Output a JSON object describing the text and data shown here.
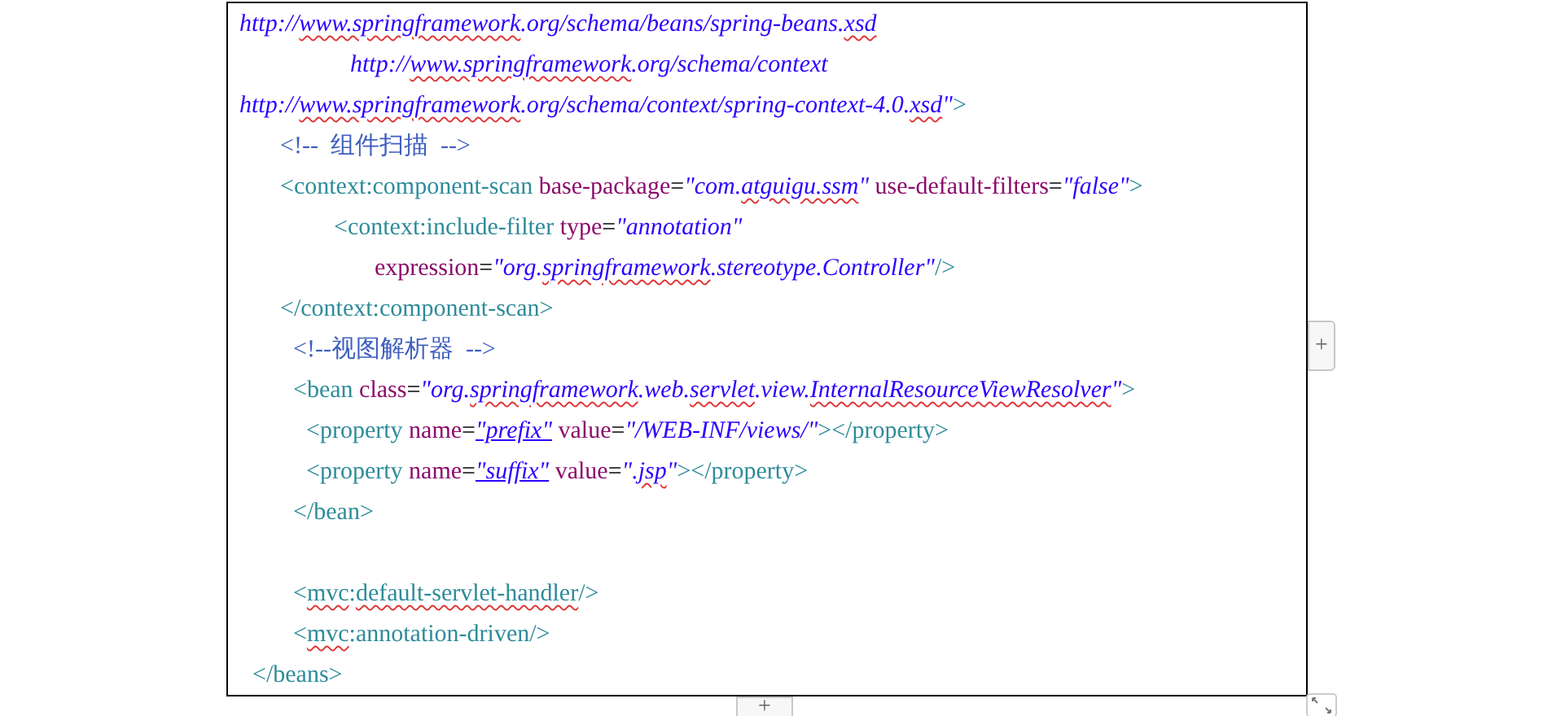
{
  "code_lines": [
    {
      "segments": [
        {
          "kind": "value",
          "text": "http://",
          "flag": false
        },
        {
          "kind": "value",
          "text": "www.springframework",
          "flag": true
        },
        {
          "kind": "value",
          "text": ".org/schema/beans/spring-beans.",
          "flag": false
        },
        {
          "kind": "value",
          "text": "xsd",
          "flag": true
        }
      ]
    },
    {
      "segments": [
        {
          "kind": "value",
          "text": "http://",
          "flag": false
        },
        {
          "kind": "value",
          "text": "www.springframework",
          "flag": true
        },
        {
          "kind": "value",
          "text": ".org/schema/context",
          "flag": false
        }
      ]
    },
    {
      "segments": [
        {
          "kind": "value",
          "text": "http://",
          "flag": false
        },
        {
          "kind": "value",
          "text": "www.springframework",
          "flag": true
        },
        {
          "kind": "value",
          "text": ".org/schema/context/spring-context-4.0.",
          "flag": false
        },
        {
          "kind": "value",
          "text": "xsd",
          "flag": true
        },
        {
          "kind": "value",
          "text": "\"",
          "flag": false
        },
        {
          "kind": "tag",
          "text": ">",
          "flag": false
        }
      ]
    },
    {
      "segments": [
        {
          "kind": "comment",
          "text": "<!--  组件扫描  -->",
          "flag": false
        }
      ]
    },
    {
      "segments": [
        {
          "kind": "tag",
          "text": "<context:component-scan ",
          "flag": false
        },
        {
          "kind": "attr",
          "text": "base-package",
          "flag": false
        },
        {
          "kind": "eq",
          "text": "=",
          "flag": false
        },
        {
          "kind": "value",
          "text": "\"com.",
          "flag": false
        },
        {
          "kind": "value",
          "text": "atguigu.ssm",
          "flag": true
        },
        {
          "kind": "value",
          "text": "\" ",
          "flag": false
        },
        {
          "kind": "attr",
          "text": "use-default-filters",
          "flag": false
        },
        {
          "kind": "eq",
          "text": "=",
          "flag": false
        },
        {
          "kind": "value",
          "text": "\"false\"",
          "flag": false
        },
        {
          "kind": "tag",
          "text": ">",
          "flag": false
        }
      ]
    },
    {
      "segments": [
        {
          "kind": "tag",
          "text": "<context:include-filter ",
          "flag": false
        },
        {
          "kind": "attr",
          "text": "type",
          "flag": false
        },
        {
          "kind": "eq",
          "text": "=",
          "flag": false
        },
        {
          "kind": "value",
          "text": "\"annotation\"",
          "flag": false
        }
      ]
    },
    {
      "segments": [
        {
          "kind": "attr",
          "text": "expression",
          "flag": false
        },
        {
          "kind": "eq",
          "text": "=",
          "flag": false
        },
        {
          "kind": "value",
          "text": "\"org.",
          "flag": false
        },
        {
          "kind": "value",
          "text": "springframework",
          "flag": true
        },
        {
          "kind": "value",
          "text": ".stereotype.Controller\"",
          "flag": false
        },
        {
          "kind": "tag",
          "text": "/>",
          "flag": false
        }
      ]
    },
    {
      "segments": [
        {
          "kind": "tag",
          "text": "</context:component-scan>",
          "flag": false
        }
      ]
    },
    {
      "segments": [
        {
          "kind": "comment",
          "text": "<!--视图解析器  -->",
          "flag": false
        }
      ]
    },
    {
      "segments": [
        {
          "kind": "tag",
          "text": "<bean ",
          "flag": false
        },
        {
          "kind": "attr",
          "text": "class",
          "flag": false
        },
        {
          "kind": "eq",
          "text": "=",
          "flag": false
        },
        {
          "kind": "value",
          "text": "\"org.",
          "flag": false
        },
        {
          "kind": "value",
          "text": "springframework",
          "flag": true
        },
        {
          "kind": "value",
          "text": ".web.",
          "flag": false
        },
        {
          "kind": "value",
          "text": "servlet",
          "flag": true
        },
        {
          "kind": "value",
          "text": ".view.",
          "flag": false
        },
        {
          "kind": "value",
          "text": "InternalResourceViewResolver",
          "flag": true
        },
        {
          "kind": "value",
          "text": "\"",
          "flag": false
        },
        {
          "kind": "tag",
          "text": ">",
          "flag": false
        }
      ]
    },
    {
      "segments": [
        {
          "kind": "tag",
          "text": "<property ",
          "flag": false
        },
        {
          "kind": "attr",
          "text": "name",
          "flag": false
        },
        {
          "kind": "eq",
          "text": "=",
          "flag": false
        },
        {
          "kind": "link",
          "text": "\"prefix\"",
          "flag": false
        },
        {
          "kind": "attr",
          "text": " value",
          "flag": false
        },
        {
          "kind": "eq",
          "text": "=",
          "flag": false
        },
        {
          "kind": "value",
          "text": "\"/WEB-INF/views/\"",
          "flag": false
        },
        {
          "kind": "tag",
          "text": "></property>",
          "flag": false
        }
      ]
    },
    {
      "segments": [
        {
          "kind": "tag",
          "text": "<property ",
          "flag": false
        },
        {
          "kind": "attr",
          "text": "name",
          "flag": false
        },
        {
          "kind": "eq",
          "text": "=",
          "flag": false
        },
        {
          "kind": "link",
          "text": "\"suffix\"",
          "flag": false
        },
        {
          "kind": "attr",
          "text": " value",
          "flag": false
        },
        {
          "kind": "eq",
          "text": "=",
          "flag": false
        },
        {
          "kind": "value",
          "text": "\".",
          "flag": false
        },
        {
          "kind": "value",
          "text": "jsp",
          "flag": true
        },
        {
          "kind": "value",
          "text": "\"",
          "flag": false
        },
        {
          "kind": "tag",
          "text": "></property>",
          "flag": false
        }
      ]
    },
    {
      "segments": [
        {
          "kind": "tag",
          "text": "</bean>",
          "flag": false
        }
      ]
    },
    {
      "segments": [
        {
          "kind": "tag",
          "text": "<",
          "flag": false
        },
        {
          "kind": "tag",
          "text": "mvc",
          "flag": true
        },
        {
          "kind": "tag",
          "text": ":",
          "flag": false
        },
        {
          "kind": "tag",
          "text": "default-servlet-handler",
          "flag": true
        },
        {
          "kind": "tag",
          "text": "/>",
          "flag": false
        }
      ]
    },
    {
      "segments": [
        {
          "kind": "tag",
          "text": "<",
          "flag": false
        },
        {
          "kind": "tag",
          "text": "mvc",
          "flag": true
        },
        {
          "kind": "tag",
          "text": ":annotation-driven/>",
          "flag": false
        }
      ]
    },
    {
      "segments": [
        {
          "kind": "tag",
          "text": "</beans>",
          "flag": false
        }
      ]
    }
  ],
  "add_column_button": "+",
  "add_row_button": "+"
}
